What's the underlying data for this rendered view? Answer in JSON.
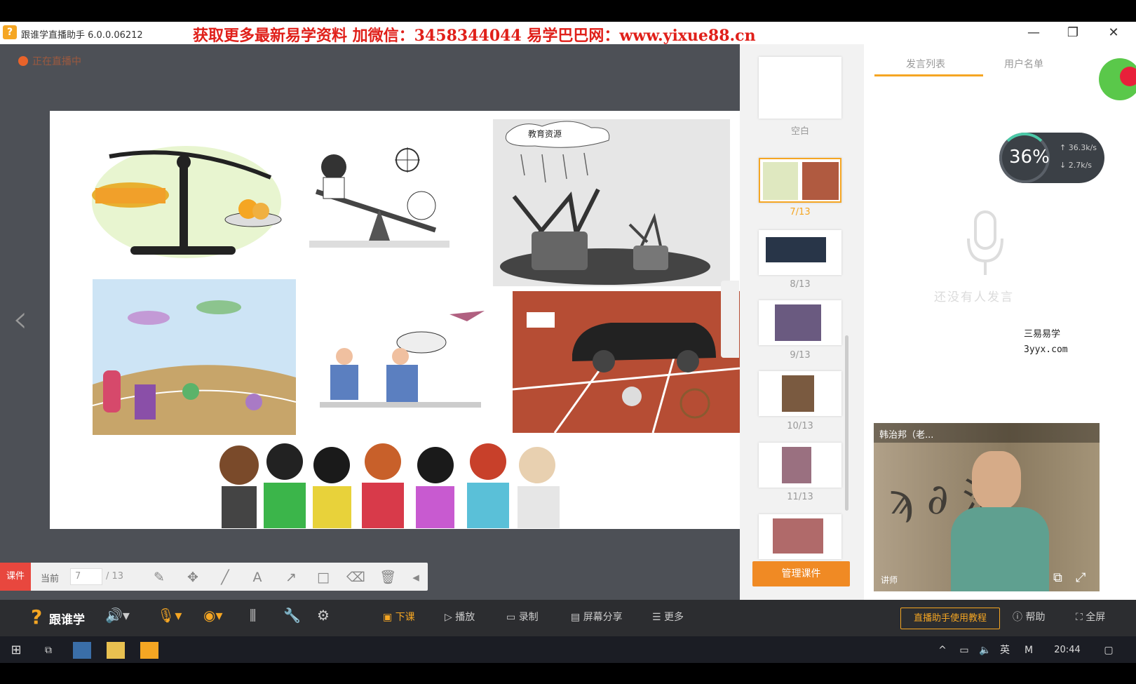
{
  "titlebar": {
    "app_title": "跟谁学直播助手 6.0.0.06212",
    "promo_text": "获取更多最新易学资料 加微信：3458344044 易学巴巴网：www.yixue88.cn",
    "minimize": "—",
    "restore": "❐",
    "close": "✕"
  },
  "stage": {
    "recording_label": "正在直播中",
    "slide_caption": "教育资源"
  },
  "slide_toolbar": {
    "mode_label": "课件",
    "page_label": "当前",
    "page_value": "7",
    "page_total": "/ 13"
  },
  "thumbnails": [
    {
      "label": "空白"
    },
    {
      "label": "7/13"
    },
    {
      "label": "8/13"
    },
    {
      "label": "9/13"
    },
    {
      "label": "10/13"
    },
    {
      "label": "11/13"
    },
    {
      "label": ""
    }
  ],
  "manage_button": "管理课件",
  "chat": {
    "tab_speech": "发言列表",
    "tab_users": "用户名单",
    "gauge_value": "36%",
    "gauge_up": "↑ 36.3k/s",
    "gauge_down": "↓ 2.7k/s",
    "empty_text": "还没有人发言"
  },
  "watermark": {
    "line1": "三易易学",
    "line2": "3yyx.com"
  },
  "video": {
    "name": "韩治邦（老...",
    "tag": "讲师"
  },
  "bottombar": {
    "brand": "跟谁学",
    "class_end": "下课",
    "play": "播放",
    "record": "录制",
    "screen_share": "屏幕分享",
    "more": "更多",
    "tutorial": "直播助手使用教程",
    "help": "帮助",
    "fullscreen": "全屏"
  },
  "taskbar": {
    "lang": "英",
    "clock": "20:44"
  },
  "colors": {
    "accent": "#f5a623",
    "promo": "#e0201a",
    "record": "#e8632a"
  }
}
